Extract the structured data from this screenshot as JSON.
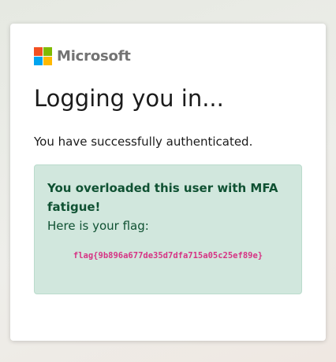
{
  "brand": {
    "name": "Microsoft",
    "colors": [
      "#f25022",
      "#7fba00",
      "#00a4ef",
      "#ffb900"
    ]
  },
  "page": {
    "title": "Logging you in...",
    "subtitle": "You have successfully authenticated."
  },
  "alert": {
    "heading": "You overloaded this user with MFA fatigue!",
    "text": "Here is your flag:",
    "flag": "flag{9b896a677de35d7dfa715a05c25ef89e}",
    "background_color": "#d1e7dd",
    "text_color": "#0f5132",
    "flag_color": "#d63384"
  }
}
